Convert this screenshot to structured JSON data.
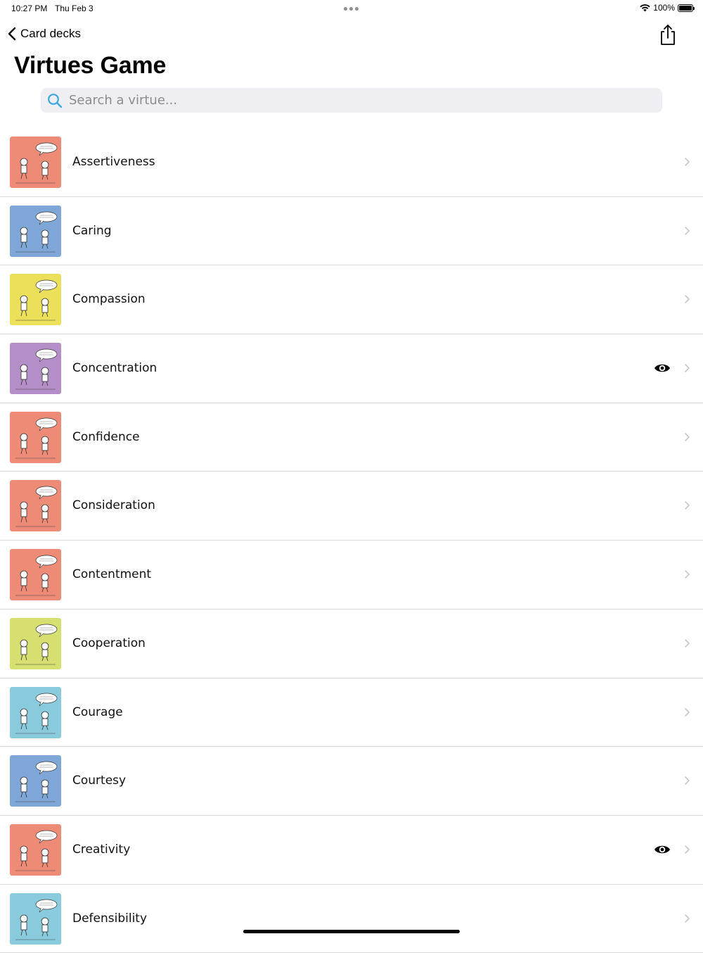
{
  "status_bar": {
    "time": "10:27 PM",
    "date": "Thu Feb 3",
    "battery": "100%"
  },
  "nav": {
    "back_label": "Card decks",
    "share_icon": "share-icon"
  },
  "page": {
    "title": "Virtues Game"
  },
  "search": {
    "placeholder": "Search a virtue..."
  },
  "virtues": [
    {
      "label": "Assertiveness",
      "color": "#ee8b76",
      "viewed": false
    },
    {
      "label": "Caring",
      "color": "#7ea7d8",
      "viewed": false
    },
    {
      "label": "Compassion",
      "color": "#ece05b",
      "viewed": false
    },
    {
      "label": "Concentration",
      "color": "#b48fc7",
      "viewed": true
    },
    {
      "label": "Confidence",
      "color": "#ee8b76",
      "viewed": false
    },
    {
      "label": "Consideration",
      "color": "#ee8b76",
      "viewed": false
    },
    {
      "label": "Contentment",
      "color": "#ee8b76",
      "viewed": false
    },
    {
      "label": "Cooperation",
      "color": "#d6e070",
      "viewed": false
    },
    {
      "label": "Courage",
      "color": "#89cbdc",
      "viewed": false
    },
    {
      "label": "Courtesy",
      "color": "#7ea7d8",
      "viewed": false
    },
    {
      "label": "Creativity",
      "color": "#ee8b76",
      "viewed": true
    },
    {
      "label": "Defensibility",
      "color": "#89cbdc",
      "viewed": false
    }
  ]
}
